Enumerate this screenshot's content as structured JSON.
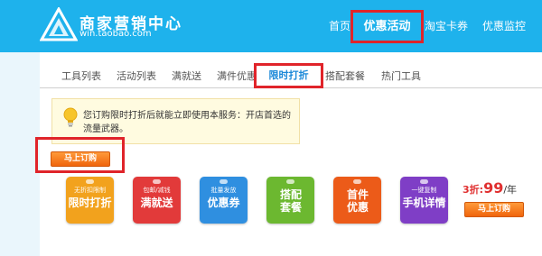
{
  "header": {
    "title": "商家营销中心",
    "url": "win.taobao.com",
    "nav": [
      "首页",
      "优惠活动",
      "淘宝卡券",
      "优惠监控"
    ]
  },
  "tabs": [
    "工具列表",
    "活动列表",
    "满就送",
    "满件优惠",
    "限时打折",
    "搭配套餐",
    "热门工具"
  ],
  "notice": {
    "text": "您订购限时打折后就能立即使用本服务：开店首选的流量武器。"
  },
  "subscribe_label": "马上订购",
  "tags": [
    {
      "small": "无折扣限制",
      "big": "限时打折"
    },
    {
      "small": "包邮/减钱",
      "big": "满就送"
    },
    {
      "small": "批量发放",
      "big": "优惠券"
    },
    {
      "small": "",
      "big": "搭配套餐"
    },
    {
      "small": "",
      "big": "首件优惠"
    },
    {
      "small": "一键复制",
      "big": "手机详情"
    }
  ],
  "price": {
    "prefix": "3折:",
    "amount": "99",
    "unit": "/年"
  },
  "colors": {
    "header_bg": "#1eb2ec",
    "highlight_box": "#e0242a",
    "button": "#f0650c",
    "tag_colors": [
      "#f2a21d",
      "#e23a3a",
      "#2f8fe0",
      "#6cb830",
      "#ec5b19",
      "#7f3ec6"
    ]
  }
}
